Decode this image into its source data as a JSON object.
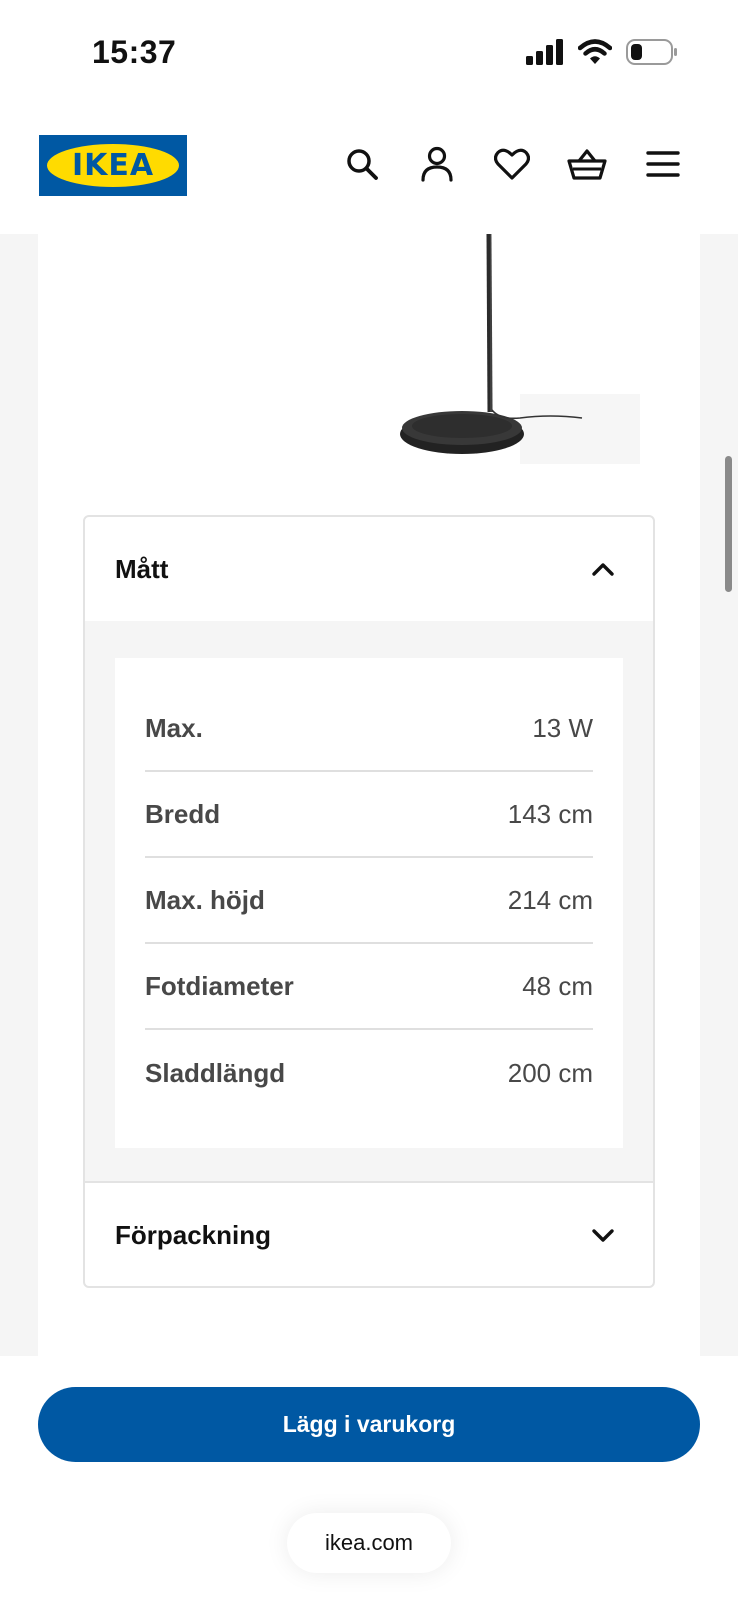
{
  "status_bar": {
    "time": "15:37",
    "icons": [
      "signal-icon",
      "wifi-icon",
      "battery-icon"
    ]
  },
  "header": {
    "logo_text": "IKEA",
    "icons": [
      "search-icon",
      "user-icon",
      "heart-icon",
      "basket-icon",
      "menu-icon"
    ]
  },
  "colors": {
    "brand_blue": "#0058a3",
    "brand_yellow": "#ffdb00",
    "page_gray": "#f5f5f5"
  },
  "accordion": {
    "dimensions": {
      "title": "Mått",
      "expanded": true,
      "rows": [
        {
          "label": "Max.",
          "value": "13 W"
        },
        {
          "label": "Bredd",
          "value": "143 cm"
        },
        {
          "label": "Max. höjd",
          "value": "214 cm"
        },
        {
          "label": "Fotdiameter",
          "value": "48 cm"
        },
        {
          "label": "Sladdlängd",
          "value": "200 cm"
        }
      ]
    },
    "packaging": {
      "title": "Förpackning",
      "expanded": false
    }
  },
  "cart_button_label": "Lägg i varukorg",
  "browser": {
    "url": "ikea.com"
  }
}
